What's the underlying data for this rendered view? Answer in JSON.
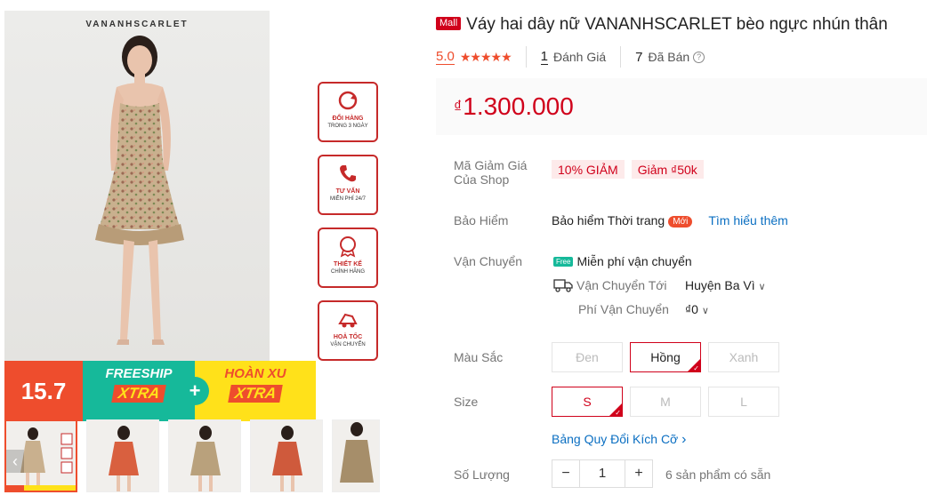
{
  "gallery": {
    "brand": "VANANHSCARLET",
    "badges": [
      {
        "icon": "refresh-icon",
        "line1": "ĐỔI HÀNG",
        "line2": "TRONG 3 NGÀY"
      },
      {
        "icon": "phone-icon",
        "line1": "TƯ VẤN",
        "line2": "MIỄN PHÍ 24/7"
      },
      {
        "icon": "certificate-icon",
        "line1": "THIẾT KẾ",
        "line2": "CHÍNH HÃNG"
      },
      {
        "icon": "delivery-icon",
        "line1": "HOẢ TỐC",
        "line2": "VẬN CHUYỂN"
      }
    ],
    "promo": {
      "date": "15.7",
      "freeship": "FREESHIP",
      "freeship_xtra": "XTRA",
      "plus": "+",
      "hoanxu": "HOÀN XU",
      "hoanxu_xtra": "XTRA"
    },
    "prev_arrow": "‹",
    "thumb_count": 5
  },
  "product": {
    "mall_label": "Mall",
    "title": "Váy hai dây nữ VANANHSCARLET bèo ngực nhún thân",
    "rating": "5.0",
    "stars": "★★★★★",
    "review_count": "1",
    "review_label": "Đánh Giá",
    "sold_count": "7",
    "sold_label": "Đã Bán",
    "help_icon": "?",
    "currency": "₫",
    "price": "1.300.000"
  },
  "details": {
    "voucher_label": "Mã Giảm Giá Của Shop",
    "vouchers": [
      "10% GIẢM",
      "Giảm ₫50k"
    ],
    "insurance_label": "Bảo Hiểm",
    "insurance_value": "Bảo hiểm Thời trang",
    "insurance_new": "Mới",
    "insurance_link": "Tìm hiểu thêm",
    "shipping_label": "Vận Chuyển",
    "free_tag": "Free",
    "free_shipping": "Miễn phí vận chuyển",
    "ship_to_label": "Vận Chuyển Tới",
    "ship_to_value": "Huyện Ba Vì",
    "ship_fee_label": "Phí Vận Chuyển",
    "ship_fee_value": "₫0",
    "chevron": "∨",
    "color_label": "Màu Sắc",
    "colors": [
      "Đen",
      "Hồng",
      "Xanh"
    ],
    "size_label": "Size",
    "sizes": [
      "S",
      "M",
      "L"
    ],
    "size_chart": "Bảng Quy Đổi Kích Cỡ",
    "size_chart_arrow": "›",
    "qty_label": "Số Lượng",
    "qty_minus": "−",
    "qty_value": "1",
    "qty_plus": "+",
    "stock": "6 sản phẩm có sẵn"
  },
  "colors": {
    "accent": "#d0011b",
    "shopee": "#ee4d2d",
    "teal": "#16b99a",
    "yellow": "#ffe11a",
    "link": "#0b6fc2"
  }
}
